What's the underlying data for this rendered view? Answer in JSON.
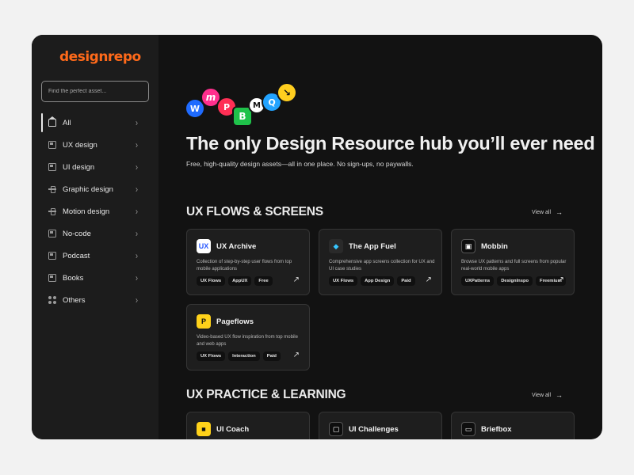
{
  "brand": {
    "logo_text": "designrepo",
    "accent": "#ff6a1a"
  },
  "search": {
    "placeholder": "Find the perfect asset..."
  },
  "sidebar": {
    "items": [
      {
        "label": "All",
        "icon": "home-icon",
        "active": true
      },
      {
        "label": "UX design",
        "icon": "ux-design-icon"
      },
      {
        "label": "UI design",
        "icon": "ui-design-icon"
      },
      {
        "label": "Graphic design",
        "icon": "graphic-design-icon"
      },
      {
        "label": "Motion design",
        "icon": "motion-design-icon"
      },
      {
        "label": "No-code",
        "icon": "no-code-icon"
      },
      {
        "label": "Podcast",
        "icon": "podcast-icon"
      },
      {
        "label": "Books",
        "icon": "books-icon"
      },
      {
        "label": "Others",
        "icon": "others-icon"
      }
    ]
  },
  "hero": {
    "title": "The only Design Resource hub you’ll ever need",
    "subtitle": "Free, high-quality design assets—all in one place. No sign-ups, no paywalls.",
    "bubbles": [
      {
        "glyph": "W",
        "color": "#1f6bff"
      },
      {
        "glyph": "m",
        "color": "#ff2f8e"
      },
      {
        "glyph": "P",
        "color": "#ff2f55"
      },
      {
        "glyph": "B",
        "color": "#1fc24a"
      },
      {
        "glyph": "M",
        "color": "#ffffff"
      },
      {
        "glyph": "Q",
        "color": "#22a3ff"
      },
      {
        "glyph": "↘",
        "color": "#ffce1f"
      }
    ]
  },
  "sections": [
    {
      "title": "UX FLOWS & SCREENS",
      "view_all": "View all",
      "cards": [
        {
          "title": "UX Archive",
          "logo": "UX",
          "logo_bg": "#ffffff",
          "logo_fg": "#2757ff",
          "desc": "Collection of step-by-step user flows from top mobile applications",
          "tags": [
            "UX Flows",
            "AppUX",
            "Free"
          ]
        },
        {
          "title": "The App Fuel",
          "logo": "◆",
          "logo_bg": "#2a2a2a",
          "logo_fg": "#36c6ff",
          "desc": "Comprehensive app screens collection for UX and UI case studies",
          "tags": [
            "UX Flows",
            "App Design",
            "Paid"
          ]
        },
        {
          "title": "Mobbin",
          "logo": "▣",
          "logo_bg": "#0e0e0e",
          "logo_fg": "#ffffff",
          "desc": "Browse UX patterns and full screens from popular real-world mobile apps",
          "tags": [
            "UXPatterns",
            "DesignInspo",
            "Freemium"
          ]
        },
        {
          "title": "Pageflows",
          "logo": "P",
          "logo_bg": "#ffd21a",
          "logo_fg": "#111111",
          "desc": "Video-based UX flow inspiration from top mobile and web apps",
          "tags": [
            "UX Flows",
            "Interaction",
            "Paid"
          ]
        }
      ]
    },
    {
      "title": "UX PRACTICE & LEARNING",
      "view_all": "View all",
      "cards": [
        {
          "title": "UI Coach",
          "logo": "■",
          "logo_bg": "#ffd21a",
          "logo_fg": "#111111"
        },
        {
          "title": "UI Challenges",
          "logo": "▢",
          "logo_bg": "#0e0e0e",
          "logo_fg": "#ffffff"
        },
        {
          "title": "Briefbox",
          "logo": "▭",
          "logo_bg": "#0e0e0e",
          "logo_fg": "#ffffff"
        }
      ]
    }
  ]
}
